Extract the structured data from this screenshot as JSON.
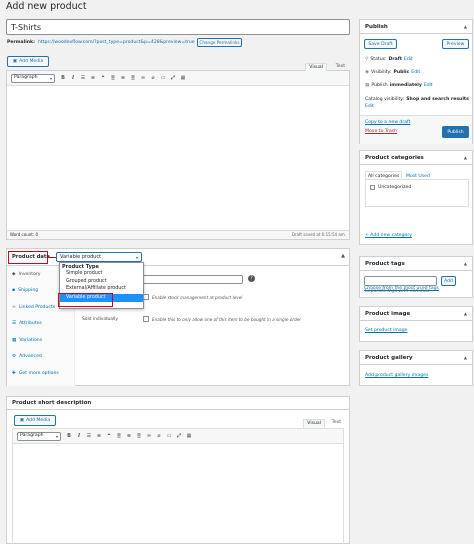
{
  "page_title": "Add new product",
  "product_name": "T-Shirts",
  "permalink": {
    "label": "Permalink:",
    "url": "https://woodevflow.com/?post_type=product&p=428&preview=true",
    "change_label": "Change Permalinks"
  },
  "editor": {
    "add_media": "Add Media",
    "tab_visual": "Visual",
    "tab_text": "Text",
    "format": "Paragraph",
    "word_count": "Word count: 0",
    "draft_saved": "Draft saved at 6:15:54 am."
  },
  "product_data": {
    "label": "Product data",
    "type_select": "Variable product",
    "dropdown": {
      "group_label": "Product Type",
      "options": [
        "Simple product",
        "Grouped product",
        "External/Affiliate product",
        "Variable product"
      ],
      "selected": "Variable product"
    },
    "tabs": [
      "Inventory",
      "Shipping",
      "Linked Products",
      "Attributes",
      "Variations",
      "Advanced",
      "Get more options"
    ],
    "manage_stock_text": "Enable stock management at product level",
    "sold_individually_label": "Sold individually",
    "sold_individually_text": "Enable this to only allow one of this item to be bought in a single order"
  },
  "short_description": {
    "title": "Product short description",
    "add_media": "Add Media",
    "tab_visual": "Visual",
    "tab_text": "Text",
    "format": "Paragraph"
  },
  "publish": {
    "title": "Publish",
    "save_draft": "Save Draft",
    "preview": "Preview",
    "status_label": "Status:",
    "status_value": "Draft",
    "visibility_label": "Visibility:",
    "visibility_value": "Public",
    "publish_label": "Publish",
    "publish_value": "immediately",
    "edit": "Edit",
    "catalog_label": "Catalog visibility:",
    "catalog_value": "Shop and search results",
    "copy_draft": "Copy to a new draft",
    "move_trash": "Move to Trash",
    "publish_button": "Publish"
  },
  "categories": {
    "title": "Product categories",
    "tab_all": "All categories",
    "tab_most_used": "Most Used",
    "item": "Uncategorized",
    "add_new": "+ Add new category"
  },
  "tags": {
    "title": "Product tags",
    "add": "Add",
    "hint": "Separate tags with commas",
    "choose": "Choose from the most used tags"
  },
  "product_image": {
    "title": "Product image",
    "link": "Set product image"
  },
  "gallery": {
    "title": "Product gallery",
    "link": "Add product gallery images"
  }
}
